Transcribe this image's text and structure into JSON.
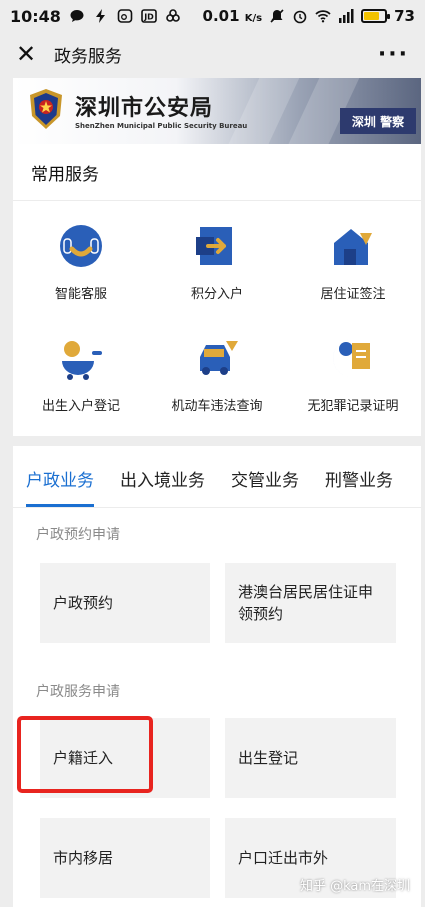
{
  "status_bar": {
    "time": "10:48",
    "speed": "0.01",
    "speed_unit": "K/s",
    "battery": "73",
    "battery_level": 0.73
  },
  "nav": {
    "title": "政务服务",
    "close_icon": "close-icon",
    "more_icon": "more-icon"
  },
  "banner": {
    "title": "深圳市公安局",
    "subtitle": "ShenZhen Municipal Public Security Bureau",
    "sign_text": "深圳 警察"
  },
  "common_services": {
    "header": "常用服务",
    "items": [
      {
        "label": "智能客服",
        "icon": "customer-service-icon"
      },
      {
        "label": "积分入户",
        "icon": "points-household-icon"
      },
      {
        "label": "居住证签注",
        "icon": "residence-permit-icon"
      },
      {
        "label": "出生入户登记",
        "icon": "birth-registration-icon"
      },
      {
        "label": "机动车违法查询",
        "icon": "vehicle-violation-icon"
      },
      {
        "label": "无犯罪记录证明",
        "icon": "no-crime-record-icon"
      }
    ]
  },
  "tabs": [
    {
      "label": "户政业务",
      "active": true
    },
    {
      "label": "出入境业务",
      "active": false
    },
    {
      "label": "交管业务",
      "active": false
    },
    {
      "label": "刑警业务",
      "active": false
    }
  ],
  "sections": {
    "appointment": {
      "title": "户政预约申请",
      "items": [
        "户政预约",
        "港澳台居民居住证申领预约"
      ]
    },
    "service": {
      "title": "户政服务申请",
      "items": [
        "户籍迁入",
        "出生登记",
        "市内移居",
        "户口迁出市外"
      ]
    }
  },
  "watermark": "知乎 @kam在深圳",
  "colors": {
    "accent": "#1a6fd1",
    "highlight": "#e8241f",
    "icon_blue": "#2a5fb8",
    "icon_gold": "#e0a93a"
  }
}
